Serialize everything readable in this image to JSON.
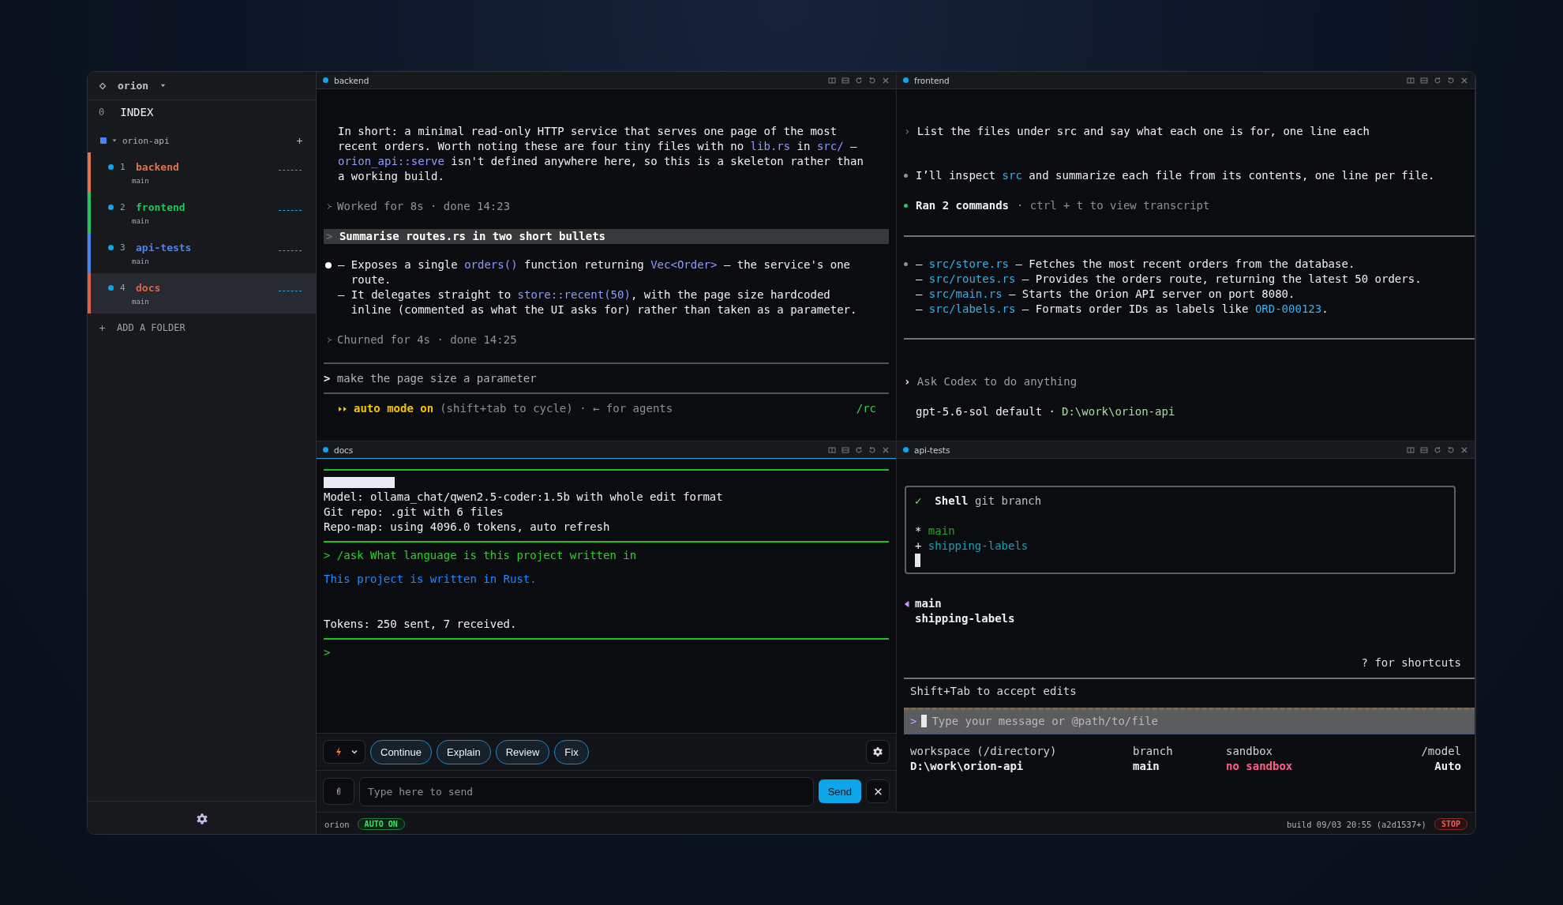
{
  "sidebar": {
    "workspace": "orion",
    "index": {
      "number": "0",
      "label": "INDEX"
    },
    "folder": {
      "name": "orion-api",
      "expanded": true
    },
    "sessions": [
      {
        "number": "1",
        "name": "backend",
        "branch": "main",
        "color": "#e2734e",
        "selected": false
      },
      {
        "number": "2",
        "name": "frontend",
        "branch": "main",
        "color": "#22c55e",
        "selected": false
      },
      {
        "number": "3",
        "name": "api-tests",
        "branch": "main",
        "color": "#4a84f0",
        "selected": false
      },
      {
        "number": "4",
        "name": "docs",
        "branch": "main",
        "color": "#e0604a",
        "selected": true
      }
    ],
    "add_folder": "ADD A FOLDER"
  },
  "backend_pane": {
    "title": "backend",
    "focused": false,
    "intro": [
      {
        "text": "In short: a minimal read-only HTTP service that serves one page of the most recent orders. Worth noting these are four tiny files with no ",
        "kind": "text"
      },
      {
        "text": "lib.rs",
        "kind": "code"
      },
      {
        "text": " in ",
        "kind": "text"
      },
      {
        "text": "src/",
        "kind": "code"
      },
      {
        "text": " – ",
        "kind": "text"
      },
      {
        "text": "orion_api::serve",
        "kind": "code"
      },
      {
        "text": " isn't defined anywhere here, so this is a skeleton rather than a working build.",
        "kind": "text"
      }
    ],
    "worked": "Worked for 8s · done 14:23",
    "prompt_marker": ">",
    "prompt": "Summarise routes.rs in two short bullets",
    "bullets": [
      [
        {
          "text": "– Exposes a single ",
          "kind": "text"
        },
        {
          "text": "orders()",
          "kind": "code"
        },
        {
          "text": " function returning ",
          "kind": "text"
        },
        {
          "text": "Vec<Order>",
          "kind": "code"
        },
        {
          "text": " – the service's one route.",
          "kind": "text"
        }
      ],
      [
        {
          "text": "– It delegates straight to ",
          "kind": "text"
        },
        {
          "text": "store::recent(50)",
          "kind": "code"
        },
        {
          "text": ", with the page size hardcoded inline (commented as what the UI asks for) rather than taken as a parameter.",
          "kind": "text"
        }
      ]
    ],
    "churned": "Churned for 4s · done 14:25",
    "input": {
      "marker": ">",
      "value": "make the page size a parameter"
    },
    "mode": {
      "label": "auto mode on",
      "hint": "(shift+tab to cycle) · ← for agents",
      "command": "/rc"
    }
  },
  "frontend_pane": {
    "title": "frontend",
    "focused": false,
    "request_marker": "›",
    "request": "List the files under src and say what each one is for, one line each",
    "plan": [
      {
        "text": "I’ll inspect ",
        "kind": "text"
      },
      {
        "text": "src",
        "kind": "code"
      },
      {
        "text": " and summarize each file from its contents, one line per file.",
        "kind": "text"
      }
    ],
    "ran": {
      "label": "Ran 2 commands",
      "hint": "· ctrl + t to view transcript"
    },
    "files": [
      [
        {
          "text": "– ",
          "kind": "text"
        },
        {
          "text": "src/store.rs",
          "kind": "code"
        },
        {
          "text": " – Fetches the most recent orders from the database.",
          "kind": "text"
        }
      ],
      [
        {
          "text": "– ",
          "kind": "text"
        },
        {
          "text": "src/routes.rs",
          "kind": "code"
        },
        {
          "text": " – Provides the orders route, returning the latest 50 orders.",
          "kind": "text"
        }
      ],
      [
        {
          "text": "– ",
          "kind": "text"
        },
        {
          "text": "src/main.rs",
          "kind": "code"
        },
        {
          "text": " – Starts the Orion API server on port 8080.",
          "kind": "text"
        }
      ],
      [
        {
          "text": "– ",
          "kind": "text"
        },
        {
          "text": "src/labels.rs",
          "kind": "code"
        },
        {
          "text": " – Formats order IDs as labels like ",
          "kind": "text"
        },
        {
          "text": "ORD-000123",
          "kind": "code"
        },
        {
          "text": ".",
          "kind": "text"
        }
      ]
    ],
    "prompt_marker": "›",
    "prompt_placeholder": "Ask Codex to do anything",
    "model": "gpt-5.6-sol default ·",
    "path": "D:\\work\\orion-api"
  },
  "docs_pane": {
    "title": "docs",
    "focused": true,
    "info": [
      "Model: ollama_chat/qwen2.5-coder:1.5b with whole edit format",
      "Git repo: .git with 6 files",
      "Repo-map: using 4096.0 tokens, auto refresh"
    ],
    "command": "> /ask What language is this project written in",
    "answer": "This project is written in Rust.",
    "tokens": "Tokens: 250 sent, 7 received.",
    "prompt": ">",
    "actions": [
      "Continue",
      "Explain",
      "Review",
      "Fix"
    ],
    "input": {
      "placeholder": "Type here to send"
    },
    "send": "Send"
  },
  "api_tests_pane": {
    "title": "api-tests",
    "focused": false,
    "tool": {
      "status": "✓",
      "name": "Shell",
      "command": "git branch",
      "output": [
        {
          "marker": "*",
          "branch": "main",
          "current": true
        },
        {
          "marker": "+",
          "branch": "shipping-labels",
          "current": false
        }
      ]
    },
    "branches": [
      {
        "name": "main",
        "selected": true
      },
      {
        "name": "shipping-labels",
        "selected": false
      }
    ],
    "shortcuts": "? for shortcuts",
    "mode_hint": "Shift+Tab to accept edits",
    "input": {
      "marker": ">",
      "placeholder": "Type your message or @path/to/file"
    },
    "footer": [
      {
        "label": "workspace (/directory)",
        "value": "D:\\work\\orion-api",
        "kind": "plain"
      },
      {
        "label": "branch",
        "value": "main",
        "kind": "plain"
      },
      {
        "label": "sandbox",
        "value": "no sandbox",
        "kind": "warning"
      },
      {
        "label": "/model",
        "value": "Auto",
        "kind": "plain"
      }
    ]
  },
  "status_bar": {
    "workspace": "orion",
    "auto": "AUTO ON",
    "build": "build 09/03 20:55 (a2d1537+)",
    "stop": "STOP"
  }
}
